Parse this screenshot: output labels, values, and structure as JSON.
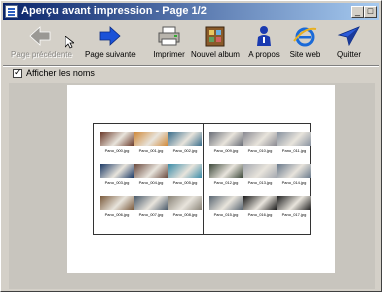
{
  "window": {
    "title": "Aperçu avant impression - Page 1/2",
    "controls": {
      "minimize": "_",
      "maximize": "□"
    }
  },
  "toolbar": {
    "prev_label": "Page précédente",
    "next_label": "Page suivante",
    "print_label": "Imprimer",
    "album_label": "Nouvel album",
    "about_label": "A propos",
    "web_label": "Site web",
    "quit_label": "Quitter"
  },
  "options": {
    "show_names_label": "Afficher les noms",
    "show_names_checked": true
  },
  "sheet": {
    "left": [
      {
        "caption": "Pano_000.jpg",
        "color": "#6b3a2a"
      },
      {
        "caption": "Pano_001.jpg",
        "color": "#d08a3a"
      },
      {
        "caption": "Pano_002.jpg",
        "color": "#3a6e8c"
      },
      {
        "caption": "Pano_003.jpg",
        "color": "#1c3a66"
      },
      {
        "caption": "Pano_004.jpg",
        "color": "#6a4a3e"
      },
      {
        "caption": "Pano_005.jpg",
        "color": "#3a8ca8"
      },
      {
        "caption": "Pano_006.jpg",
        "color": "#7a5a3c"
      },
      {
        "caption": "Pano_007.jpg",
        "color": "#4a5a6a"
      },
      {
        "caption": "Pano_008.jpg",
        "color": "#8a8478"
      }
    ],
    "right": [
      {
        "caption": "Pano_009.jpg",
        "color": "#6a6e78"
      },
      {
        "caption": "Pano_010.jpg",
        "color": "#8a8a92"
      },
      {
        "caption": "Pano_011.jpg",
        "color": "#8892a0"
      },
      {
        "caption": "Pano_012.jpg",
        "color": "#3e4a3c"
      },
      {
        "caption": "Pano_013.jpg",
        "color": "#a4a8b0"
      },
      {
        "caption": "Pano_014.jpg",
        "color": "#6a7a8c"
      },
      {
        "caption": "Pano_015.jpg",
        "color": "#5a6672"
      },
      {
        "caption": "Pano_016.jpg",
        "color": "#1a1a1a"
      },
      {
        "caption": "Pano_017.jpg",
        "color": "#222222"
      }
    ]
  }
}
